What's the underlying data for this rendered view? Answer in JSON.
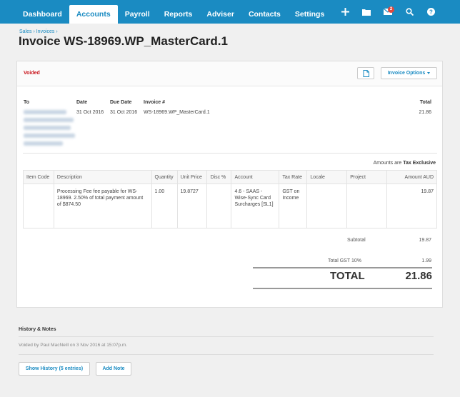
{
  "nav": {
    "items": [
      "Dashboard",
      "Accounts",
      "Payroll",
      "Reports",
      "Adviser",
      "Contacts",
      "Settings"
    ],
    "active": "Accounts",
    "mail_badge": "2"
  },
  "header": {
    "breadcrumb": "Sales › Invoices ›",
    "title": "Invoice WS-18969.WP_MasterCard.1"
  },
  "invoice": {
    "status": "Voided",
    "options_label": "Invoice Options",
    "labels": {
      "to": "To",
      "date": "Date",
      "due_date": "Due Date",
      "number": "Invoice #",
      "total": "Total"
    },
    "date": "31 Oct 2016",
    "due_date": "31 Oct 2016",
    "number": "WS-18969.WP_MasterCard.1",
    "total": "21.86",
    "amounts_are_label": "Amounts are",
    "amounts_are_value": "Tax Exclusive"
  },
  "line_table": {
    "headers": [
      "Item Code",
      "Description",
      "Quantity",
      "Unit Price",
      "Disc %",
      "Account",
      "Tax Rate",
      "Locale",
      "Project",
      "Amount AUD"
    ],
    "rows": [
      {
        "item_code": "",
        "description": "Processing Fee fee payable for WS-18969. 2.50% of total payment amount of $874.50",
        "quantity": "1.00",
        "unit_price": "19.8727",
        "disc": "",
        "account": "4.6 - SAAS - Wise-Sync Card Surcharges [SL1]",
        "tax_rate": "GST on Income",
        "locale": "",
        "project": "",
        "amount": "19.87"
      }
    ]
  },
  "totals": {
    "subtotal_label": "Subtotal",
    "subtotal": "19.87",
    "gst_label": "Total GST  10%",
    "gst": "1.99",
    "total_label": "TOTAL",
    "total": "21.86"
  },
  "history": {
    "title": "History & Notes",
    "entry": "Voided by Paul MacNeill on 3 Nov 2016 at 15:07p.m.",
    "show_history_label": "Show History (5 entries)",
    "add_note_label": "Add Note"
  },
  "colors": {
    "brand": "#1a8bc2",
    "voided": "#c9151c",
    "badge": "#e2483d"
  }
}
